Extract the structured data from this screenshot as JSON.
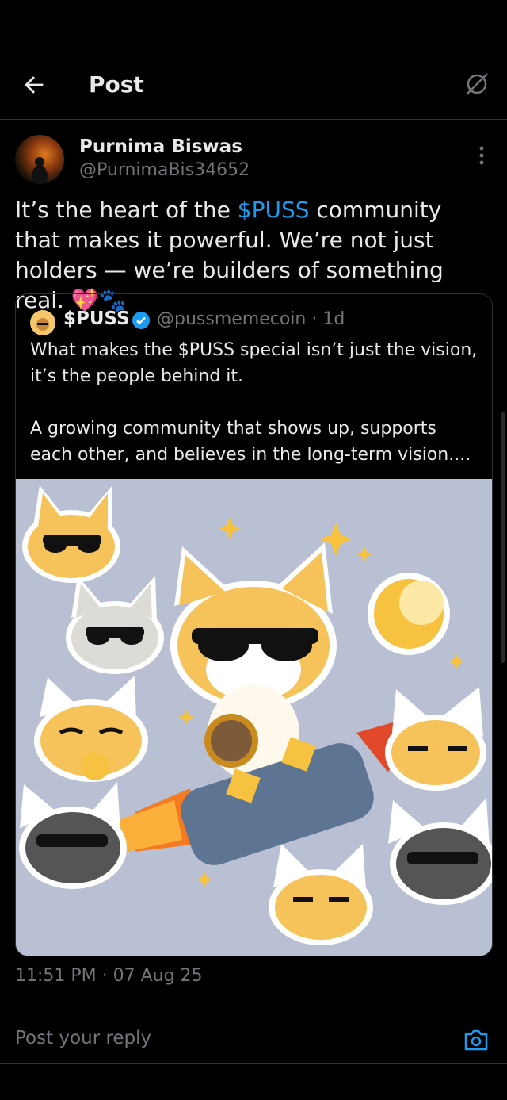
{
  "header": {
    "title": "Post"
  },
  "post": {
    "author_name": "Purnima Biswas",
    "author_handle": "@PurnimaBis34652",
    "text_part1": "It’s the heart of the ",
    "cashtag": "$PUSS",
    "text_part2": " community that makes it powerful. We’re not just holders — we’re builders of something real. ",
    "emojis": "💖🐾",
    "timestamp": "11:51 PM · 07 Aug 25"
  },
  "quoted_post": {
    "author_name": "$PUSS",
    "handle_time": "@pussmemecoin · 1d",
    "text": "What makes the $PUSS special isn’t just the vision, it’s the people behind it.\n\nA growing community that shows up, supports each other, and believes in the long-term vision....",
    "image_alt": "Cartoon cats with sunglasses riding a rocket toward a moon"
  },
  "reply": {
    "placeholder": "Post your reply"
  },
  "colors": {
    "accent": "#1d9bf0",
    "muted": "#71767b",
    "text": "#e7e9ea",
    "background": "#000000"
  }
}
